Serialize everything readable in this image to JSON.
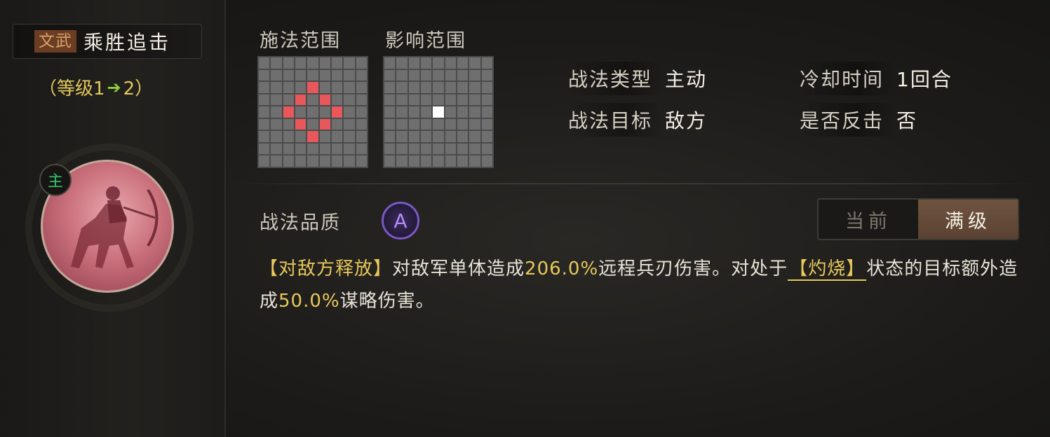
{
  "skill": {
    "type_tag": "文武",
    "name": "乘胜追击",
    "level_prefix": "（等级1",
    "level_arrow": "➔",
    "level_suffix": "2）"
  },
  "portrait": {
    "badge": "主"
  },
  "ranges": {
    "cast_label": "施法范围",
    "effect_label": "影响范围"
  },
  "info": {
    "tactic_type_label": "战法类型",
    "tactic_type_value": "主动",
    "cooldown_label": "冷却时间",
    "cooldown_value": "1回合",
    "target_label": "战法目标",
    "target_value": "敌方",
    "counter_label": "是否反击",
    "counter_value": "否"
  },
  "quality": {
    "label": "战法品质",
    "grade": "A"
  },
  "toggle": {
    "current": "当前",
    "max": "满级"
  },
  "description": {
    "tag": "【对敌方释放】",
    "part1": "对敌军单体造成",
    "value1": "206.0%",
    "part2": "远程兵刃伤害。对处于",
    "status": "【灼烧】",
    "part3": "状态的目标额外造成",
    "value2": "50.0%",
    "part4": "谋略伤害。"
  },
  "colors": {
    "highlight": "#e7c85a",
    "range_cell": "#e8585b",
    "effect_cell": "#ffffff",
    "quality": "#7a58c4",
    "main_badge": "#36c46c"
  }
}
